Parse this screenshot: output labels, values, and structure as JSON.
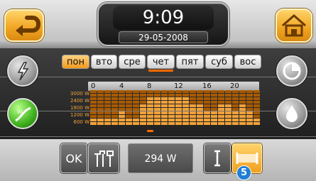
{
  "header": {
    "time": "9:09",
    "date": "29-05-2008",
    "back_icon": "back-arrow-icon",
    "home_icon": "home-icon"
  },
  "days": [
    {
      "label": "пон",
      "active": true
    },
    {
      "label": "вто",
      "active": false
    },
    {
      "label": "сре",
      "active": false
    },
    {
      "label": "чет",
      "active": false
    },
    {
      "label": "пят",
      "active": false
    },
    {
      "label": "суб",
      "active": false
    },
    {
      "label": "вос",
      "active": false
    }
  ],
  "selected_day": "чет",
  "hour_scale": [
    "0",
    "4",
    "8",
    "12",
    "16",
    "20"
  ],
  "power_levels": [
    "3000 W",
    "2400 W",
    "1800 W",
    "1200 W",
    "600 W"
  ],
  "chart_data": {
    "type": "heatmap",
    "x": [
      0,
      1,
      2,
      3,
      4,
      5,
      6,
      7,
      8,
      9,
      10,
      11,
      12,
      13,
      14,
      15,
      16,
      17,
      18,
      19,
      20,
      21,
      22,
      23
    ],
    "y_levels": [
      "3000 W",
      "2400 W",
      "1800 W",
      "1200 W",
      "600 W"
    ],
    "selected_hour": 8,
    "level_by_hour": [
      4,
      4,
      4,
      4,
      3,
      4,
      4,
      2,
      1,
      1,
      1,
      1,
      1,
      1,
      2,
      2,
      3,
      3,
      2,
      2,
      3,
      2,
      3,
      4
    ]
  },
  "left_controls": {
    "icon_1": "lightning-icon",
    "icon_2": "graph-w-icon"
  },
  "right_controls": {
    "icon_1": "pie-chart-icon",
    "icon_2": "water-drop-icon"
  },
  "bottom": {
    "ok_label": "OK",
    "tools_icon": "tools-icon",
    "watt_value": "294 W",
    "cursor_icon": "text-cursor-icon",
    "fill_icon": "fill-range-icon",
    "step_badge": "5"
  },
  "colors": {
    "accent": "#f2a23a",
    "orange_dark": "#a95a00",
    "badge": "#1f7fd8"
  }
}
